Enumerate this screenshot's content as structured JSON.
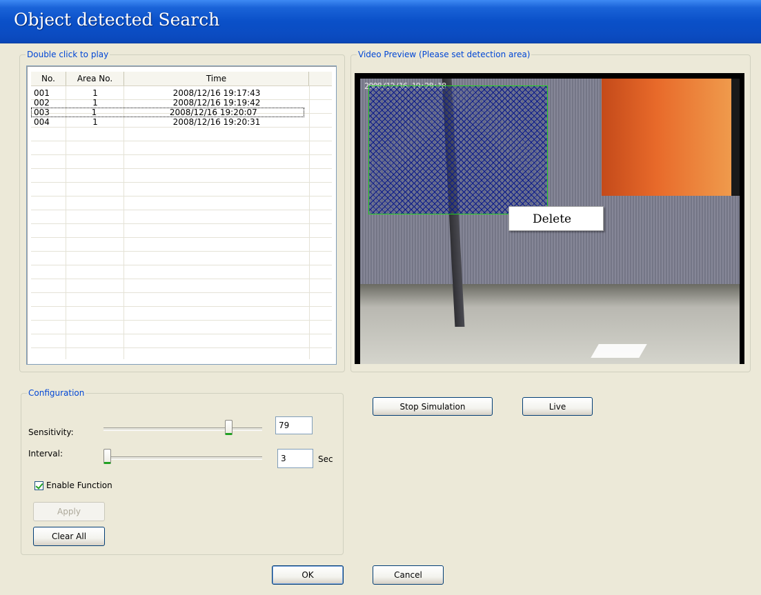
{
  "window": {
    "title": "Object detected Search"
  },
  "list_group": {
    "legend": "Double click to play"
  },
  "list": {
    "columns": [
      "No.",
      "Area No.",
      "Time"
    ],
    "rows": [
      {
        "no": "001",
        "area": "1",
        "time": "2008/12/16 19:17:43"
      },
      {
        "no": "002",
        "area": "1",
        "time": "2008/12/16 19:19:42"
      },
      {
        "no": "003",
        "area": "1",
        "time": "2008/12/16 19:20:07"
      },
      {
        "no": "004",
        "area": "1",
        "time": "2008/12/16 19:20:31"
      }
    ],
    "focused_row": 2
  },
  "preview_group": {
    "legend": "Video Preview (Please set detection area)",
    "timestamp": "2008/12/16 19:28:18",
    "context_menu": [
      "Delete"
    ]
  },
  "config_group": {
    "legend": "Configuration",
    "sensitivity_label": "Sensitivity:",
    "sensitivity_value": "79",
    "sensitivity_level": 0.79,
    "interval_label": "Interval:",
    "interval_value": "3",
    "interval_unit": "Sec",
    "interval_level": 0.0,
    "enable_label": "Enable Function",
    "enable_checked": true,
    "apply_label": "Apply",
    "clear_label": "Clear All"
  },
  "sim_buttons": {
    "stop": "Stop Simulation",
    "live": "Live"
  },
  "dialog_buttons": {
    "ok": "OK",
    "cancel": "Cancel"
  },
  "colors": {
    "title_bar": "#0a50c8",
    "legend_text": "#0046d5",
    "detect_border": "#21d321",
    "detect_grid": "#0a1a8a"
  }
}
